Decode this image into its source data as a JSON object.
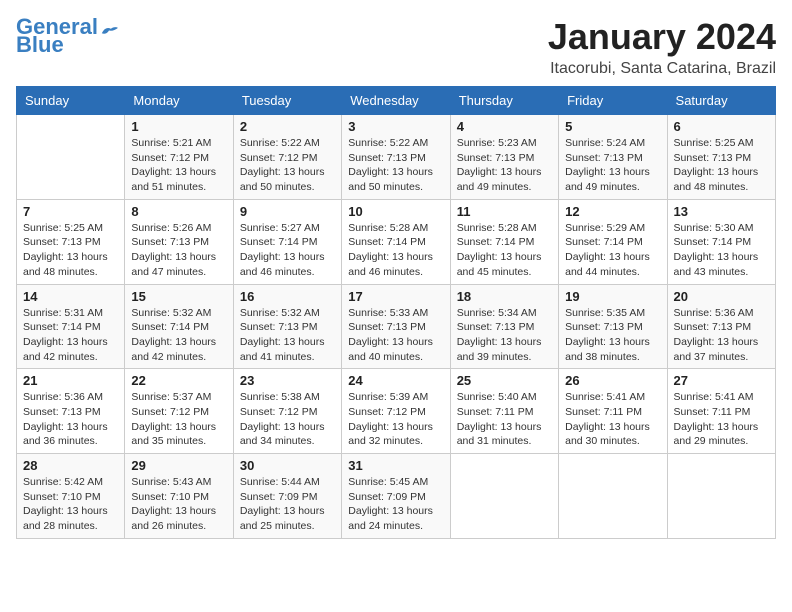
{
  "header": {
    "logo_line1": "General",
    "logo_line2": "Blue",
    "title": "January 2024",
    "subtitle": "Itacorubi, Santa Catarina, Brazil"
  },
  "weekdays": [
    "Sunday",
    "Monday",
    "Tuesday",
    "Wednesday",
    "Thursday",
    "Friday",
    "Saturday"
  ],
  "weeks": [
    [
      {
        "day": "",
        "info": ""
      },
      {
        "day": "1",
        "info": "Sunrise: 5:21 AM\nSunset: 7:12 PM\nDaylight: 13 hours\nand 51 minutes."
      },
      {
        "day": "2",
        "info": "Sunrise: 5:22 AM\nSunset: 7:12 PM\nDaylight: 13 hours\nand 50 minutes."
      },
      {
        "day": "3",
        "info": "Sunrise: 5:22 AM\nSunset: 7:13 PM\nDaylight: 13 hours\nand 50 minutes."
      },
      {
        "day": "4",
        "info": "Sunrise: 5:23 AM\nSunset: 7:13 PM\nDaylight: 13 hours\nand 49 minutes."
      },
      {
        "day": "5",
        "info": "Sunrise: 5:24 AM\nSunset: 7:13 PM\nDaylight: 13 hours\nand 49 minutes."
      },
      {
        "day": "6",
        "info": "Sunrise: 5:25 AM\nSunset: 7:13 PM\nDaylight: 13 hours\nand 48 minutes."
      }
    ],
    [
      {
        "day": "7",
        "info": "Sunrise: 5:25 AM\nSunset: 7:13 PM\nDaylight: 13 hours\nand 48 minutes."
      },
      {
        "day": "8",
        "info": "Sunrise: 5:26 AM\nSunset: 7:13 PM\nDaylight: 13 hours\nand 47 minutes."
      },
      {
        "day": "9",
        "info": "Sunrise: 5:27 AM\nSunset: 7:14 PM\nDaylight: 13 hours\nand 46 minutes."
      },
      {
        "day": "10",
        "info": "Sunrise: 5:28 AM\nSunset: 7:14 PM\nDaylight: 13 hours\nand 46 minutes."
      },
      {
        "day": "11",
        "info": "Sunrise: 5:28 AM\nSunset: 7:14 PM\nDaylight: 13 hours\nand 45 minutes."
      },
      {
        "day": "12",
        "info": "Sunrise: 5:29 AM\nSunset: 7:14 PM\nDaylight: 13 hours\nand 44 minutes."
      },
      {
        "day": "13",
        "info": "Sunrise: 5:30 AM\nSunset: 7:14 PM\nDaylight: 13 hours\nand 43 minutes."
      }
    ],
    [
      {
        "day": "14",
        "info": "Sunrise: 5:31 AM\nSunset: 7:14 PM\nDaylight: 13 hours\nand 42 minutes."
      },
      {
        "day": "15",
        "info": "Sunrise: 5:32 AM\nSunset: 7:14 PM\nDaylight: 13 hours\nand 42 minutes."
      },
      {
        "day": "16",
        "info": "Sunrise: 5:32 AM\nSunset: 7:13 PM\nDaylight: 13 hours\nand 41 minutes."
      },
      {
        "day": "17",
        "info": "Sunrise: 5:33 AM\nSunset: 7:13 PM\nDaylight: 13 hours\nand 40 minutes."
      },
      {
        "day": "18",
        "info": "Sunrise: 5:34 AM\nSunset: 7:13 PM\nDaylight: 13 hours\nand 39 minutes."
      },
      {
        "day": "19",
        "info": "Sunrise: 5:35 AM\nSunset: 7:13 PM\nDaylight: 13 hours\nand 38 minutes."
      },
      {
        "day": "20",
        "info": "Sunrise: 5:36 AM\nSunset: 7:13 PM\nDaylight: 13 hours\nand 37 minutes."
      }
    ],
    [
      {
        "day": "21",
        "info": "Sunrise: 5:36 AM\nSunset: 7:13 PM\nDaylight: 13 hours\nand 36 minutes."
      },
      {
        "day": "22",
        "info": "Sunrise: 5:37 AM\nSunset: 7:12 PM\nDaylight: 13 hours\nand 35 minutes."
      },
      {
        "day": "23",
        "info": "Sunrise: 5:38 AM\nSunset: 7:12 PM\nDaylight: 13 hours\nand 34 minutes."
      },
      {
        "day": "24",
        "info": "Sunrise: 5:39 AM\nSunset: 7:12 PM\nDaylight: 13 hours\nand 32 minutes."
      },
      {
        "day": "25",
        "info": "Sunrise: 5:40 AM\nSunset: 7:11 PM\nDaylight: 13 hours\nand 31 minutes."
      },
      {
        "day": "26",
        "info": "Sunrise: 5:41 AM\nSunset: 7:11 PM\nDaylight: 13 hours\nand 30 minutes."
      },
      {
        "day": "27",
        "info": "Sunrise: 5:41 AM\nSunset: 7:11 PM\nDaylight: 13 hours\nand 29 minutes."
      }
    ],
    [
      {
        "day": "28",
        "info": "Sunrise: 5:42 AM\nSunset: 7:10 PM\nDaylight: 13 hours\nand 28 minutes."
      },
      {
        "day": "29",
        "info": "Sunrise: 5:43 AM\nSunset: 7:10 PM\nDaylight: 13 hours\nand 26 minutes."
      },
      {
        "day": "30",
        "info": "Sunrise: 5:44 AM\nSunset: 7:09 PM\nDaylight: 13 hours\nand 25 minutes."
      },
      {
        "day": "31",
        "info": "Sunrise: 5:45 AM\nSunset: 7:09 PM\nDaylight: 13 hours\nand 24 minutes."
      },
      {
        "day": "",
        "info": ""
      },
      {
        "day": "",
        "info": ""
      },
      {
        "day": "",
        "info": ""
      }
    ]
  ]
}
